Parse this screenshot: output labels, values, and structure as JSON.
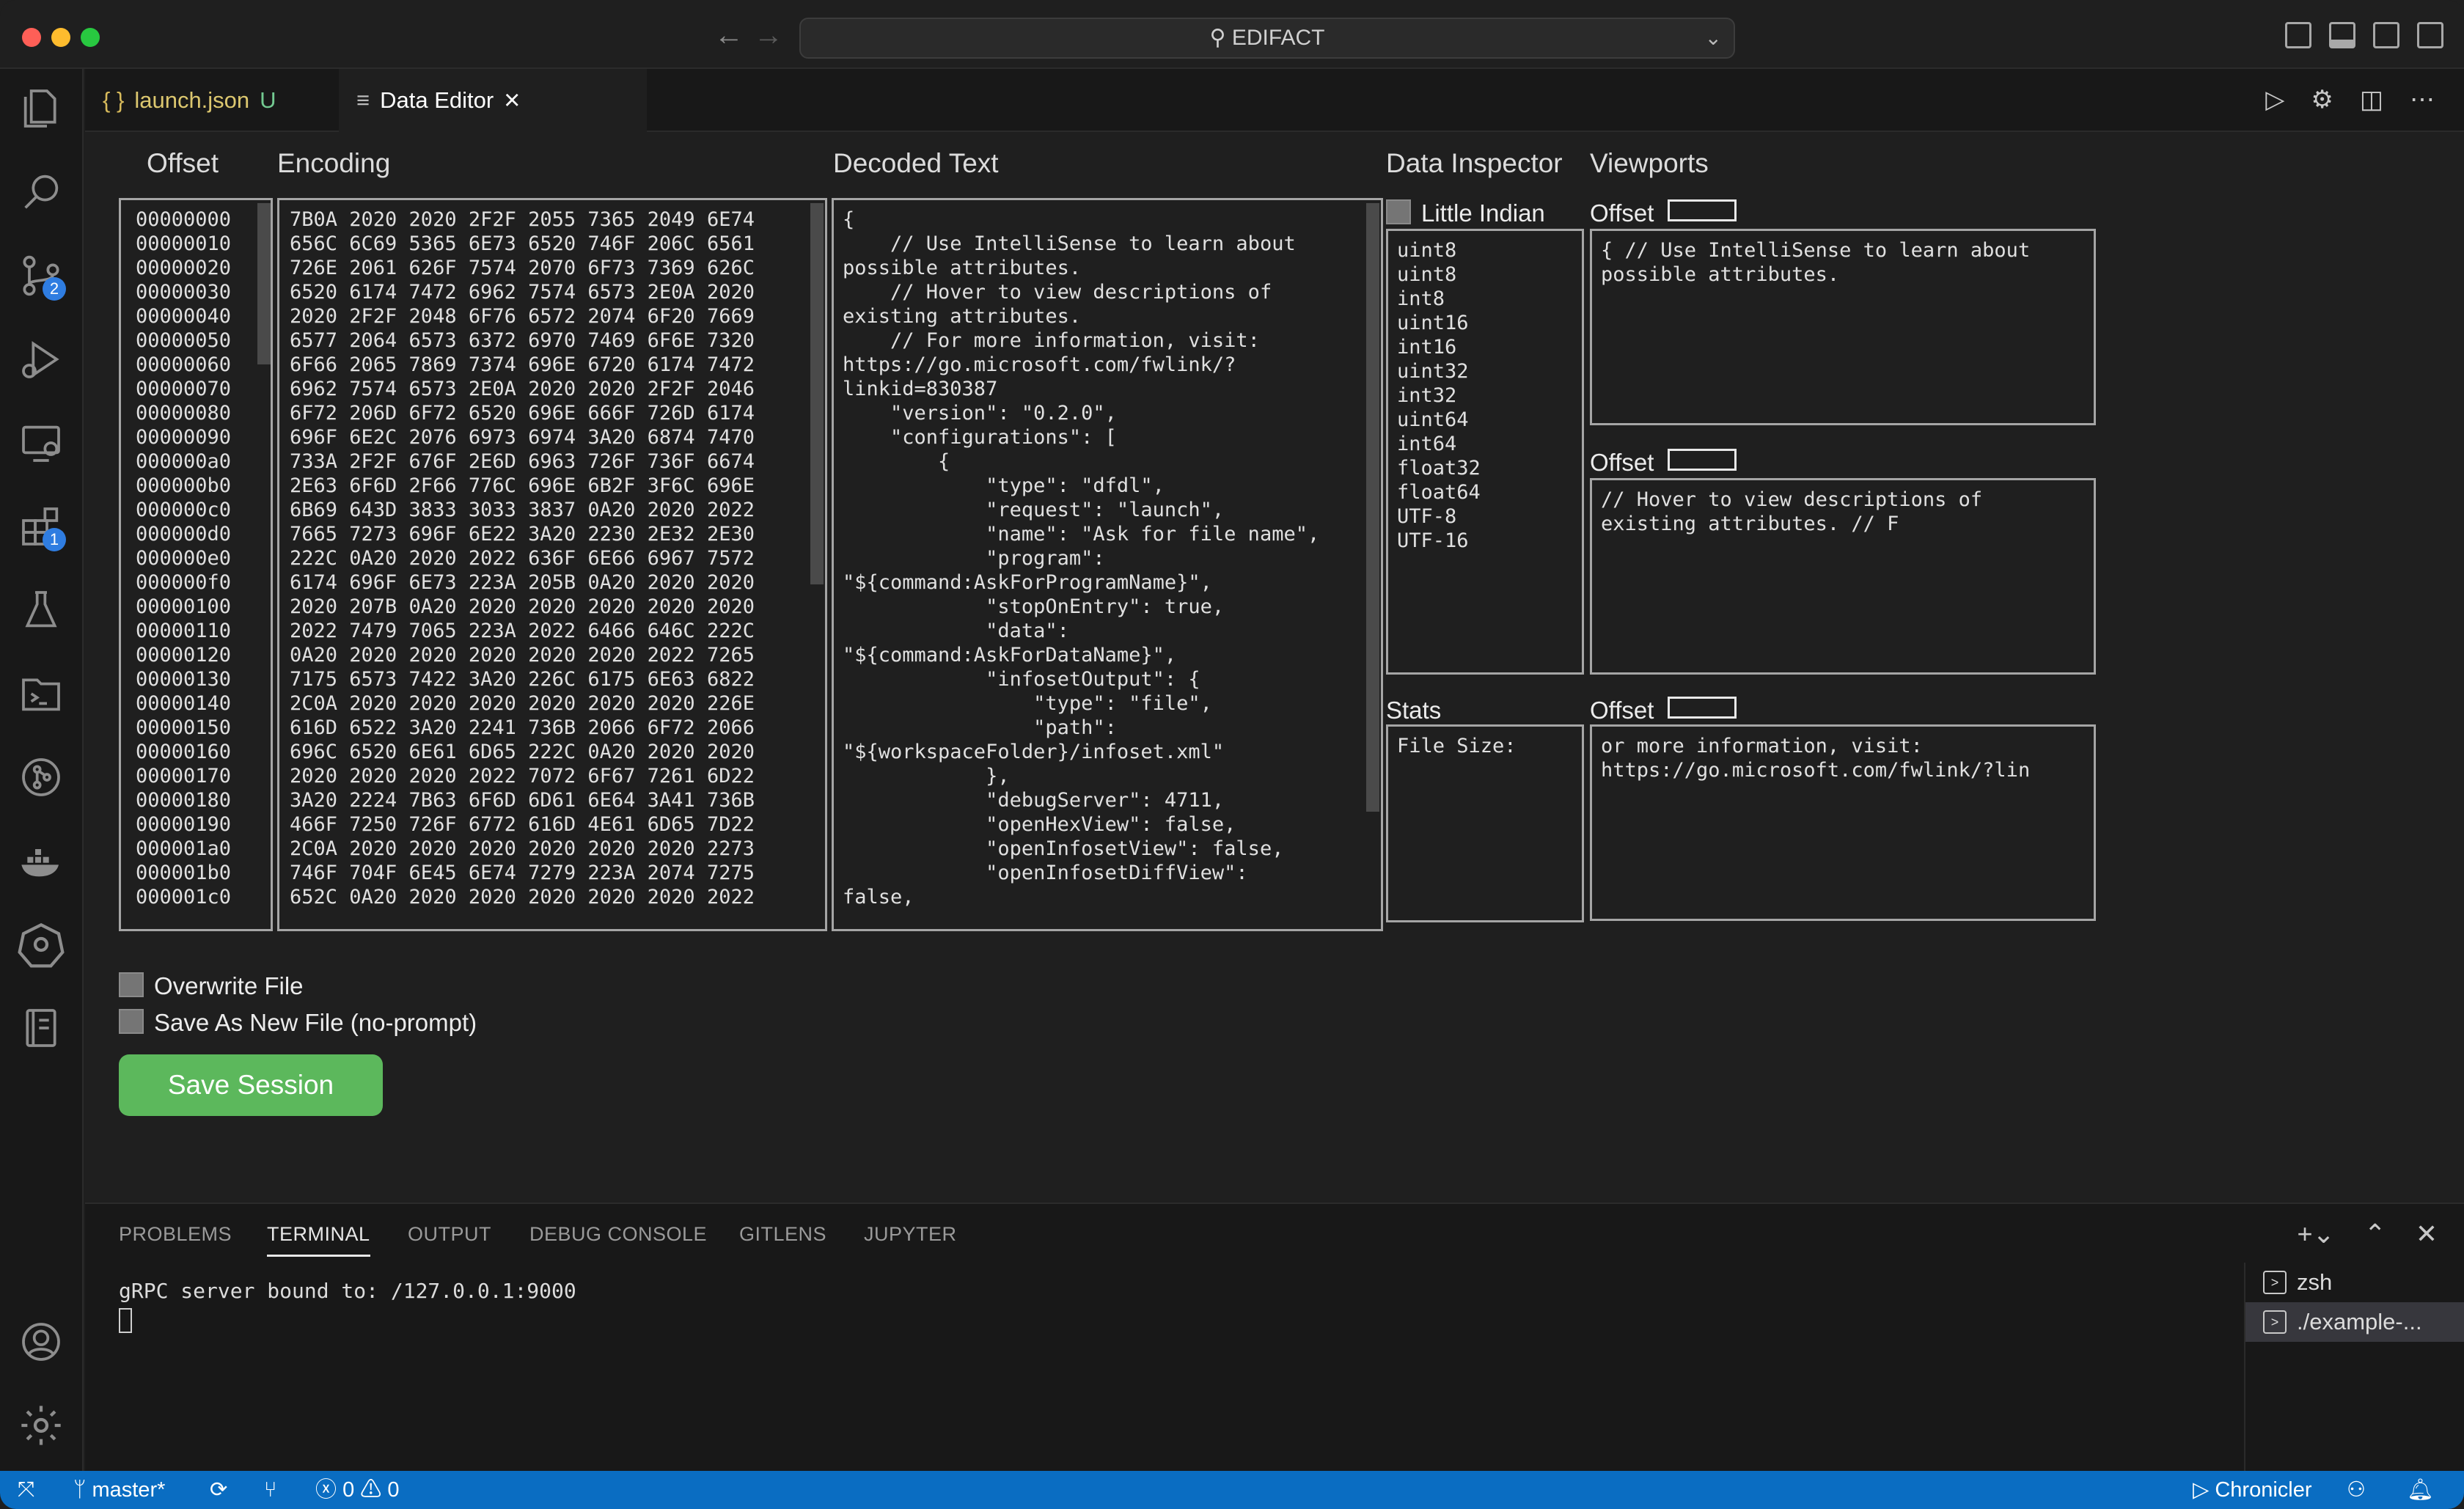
{
  "window": {
    "command_center": "EDIFACT"
  },
  "tabs": [
    {
      "icon": "{ }",
      "label": "launch.json",
      "status": "U"
    },
    {
      "icon": "≡",
      "label": "Data Editor",
      "close": "×"
    }
  ],
  "activity_badges": {
    "source_control": "2",
    "extensions": "1"
  },
  "editor": {
    "headers": {
      "offset": "Offset",
      "encoding": "Encoding",
      "decoded": "Decoded Text",
      "inspector": "Data Inspector",
      "viewports": "Viewports"
    },
    "offsets": [
      "00000000",
      "00000010",
      "00000020",
      "00000030",
      "00000040",
      "00000050",
      "00000060",
      "00000070",
      "00000080",
      "00000090",
      "000000a0",
      "000000b0",
      "000000c0",
      "000000d0",
      "000000e0",
      "000000f0",
      "00000100",
      "00000110",
      "00000120",
      "00000130",
      "00000140",
      "00000150",
      "00000160",
      "00000170",
      "00000180",
      "00000190",
      "000001a0",
      "000001b0",
      "000001c0"
    ],
    "hex": [
      "7B0A 2020 2020 2F2F 2055 7365 2049 6E74",
      "656C 6C69 5365 6E73 6520 746F 206C 6561",
      "726E 2061 626F 7574 2070 6F73 7369 626C",
      "6520 6174 7472 6962 7574 6573 2E0A 2020",
      "2020 2F2F 2048 6F76 6572 2074 6F20 7669",
      "6577 2064 6573 6372 6970 7469 6F6E 7320",
      "6F66 2065 7869 7374 696E 6720 6174 7472",
      "6962 7574 6573 2E0A 2020 2020 2F2F 2046",
      "6F72 206D 6F72 6520 696E 666F 726D 6174",
      "696F 6E2C 2076 6973 6974 3A20 6874 7470",
      "733A 2F2F 676F 2E6D 6963 726F 736F 6674",
      "2E63 6F6D 2F66 776C 696E 6B2F 3F6C 696E",
      "6B69 643D 3833 3033 3837 0A20 2020 2022",
      "7665 7273 696F 6E22 3A20 2230 2E32 2E30",
      "222C 0A20 2020 2022 636F 6E66 6967 7572",
      "6174 696F 6E73 223A 205B 0A20 2020 2020",
      "2020 207B 0A20 2020 2020 2020 2020 2020",
      "2022 7479 7065 223A 2022 6466 646C 222C",
      "0A20 2020 2020 2020 2020 2020 2022 7265",
      "7175 6573 7422 3A20 226C 6175 6E63 6822",
      "2C0A 2020 2020 2020 2020 2020 2020 226E",
      "616D 6522 3A20 2241 736B 2066 6F72 2066",
      "696C 6520 6E61 6D65 222C 0A20 2020 2020",
      "2020 2020 2020 2022 7072 6F67 7261 6D22",
      "3A20 2224 7B63 6F6D 6D61 6E64 3A41 736B",
      "466F 7250 726F 6772 616D 4E61 6D65 7D22",
      "2C0A 2020 2020 2020 2020 2020 2020 2273",
      "746F 704F 6E45 6E74 7279 223A 2074 7275",
      "652C 0A20 2020 2020 2020 2020 2020 2022"
    ],
    "decoded": [
      "{",
      "    // Use IntelliSense to learn about",
      "possible attributes.",
      "    // Hover to view descriptions of",
      "existing attributes.",
      "    // For more information, visit:",
      "https://go.microsoft.com/fwlink/?",
      "linkid=830387",
      "    \"version\": \"0.2.0\",",
      "    \"configurations\": [",
      "        {",
      "            \"type\": \"dfdl\",",
      "            \"request\": \"launch\",",
      "            \"name\": \"Ask for file name\",",
      "            \"program\":",
      "\"${command:AskForProgramName}\",",
      "            \"stopOnEntry\": true,",
      "            \"data\":",
      "\"${command:AskForDataName}\",",
      "            \"infosetOutput\": {",
      "                \"type\": \"file\",",
      "                \"path\":",
      "\"${workspaceFolder}/infoset.xml\"",
      "            },",
      "            \"debugServer\": 4711,",
      "            \"openHexView\": false,",
      "            \"openInfosetView\": false,",
      "            \"openInfosetDiffView\":",
      "false,"
    ],
    "endianness_label": "Little Indian",
    "inspector_types": [
      "uint8",
      "uint8",
      "int8",
      "uint16",
      "int16",
      "uint32",
      "int32",
      "uint64",
      "int64",
      "float32",
      "float64",
      "UTF-8",
      "UTF-16"
    ],
    "stats_label": "Stats",
    "file_size_label": "File Size:",
    "viewport_offset_label": "Offset",
    "viewports": [
      "{ // Use IntelliSense to learn about\npossible attributes.",
      "// Hover to view descriptions of\nexisting attributes. // F",
      "or more information, visit:\nhttps://go.microsoft.com/fwlink/?lin"
    ],
    "overwrite_label": "Overwrite File",
    "save_new_label": "Save As New File (no-prompt)",
    "save_button": "Save Session"
  },
  "panel": {
    "tabs": [
      "PROBLEMS",
      "TERMINAL",
      "OUTPUT",
      "DEBUG CONSOLE",
      "GITLENS",
      "JUPYTER"
    ],
    "active_tab": "TERMINAL",
    "terminal_output": "gRPC server bound to: /127.0.0.1:9000",
    "terminals": [
      "zsh",
      "./example-..."
    ]
  },
  "statusbar": {
    "branch": "master*",
    "errors": "0",
    "warnings": "0",
    "chronicler": "Chronicler"
  },
  "colors": {
    "accent": "#0a6dc2",
    "save_button": "#5cb85c",
    "badge": "#2f7de1"
  }
}
